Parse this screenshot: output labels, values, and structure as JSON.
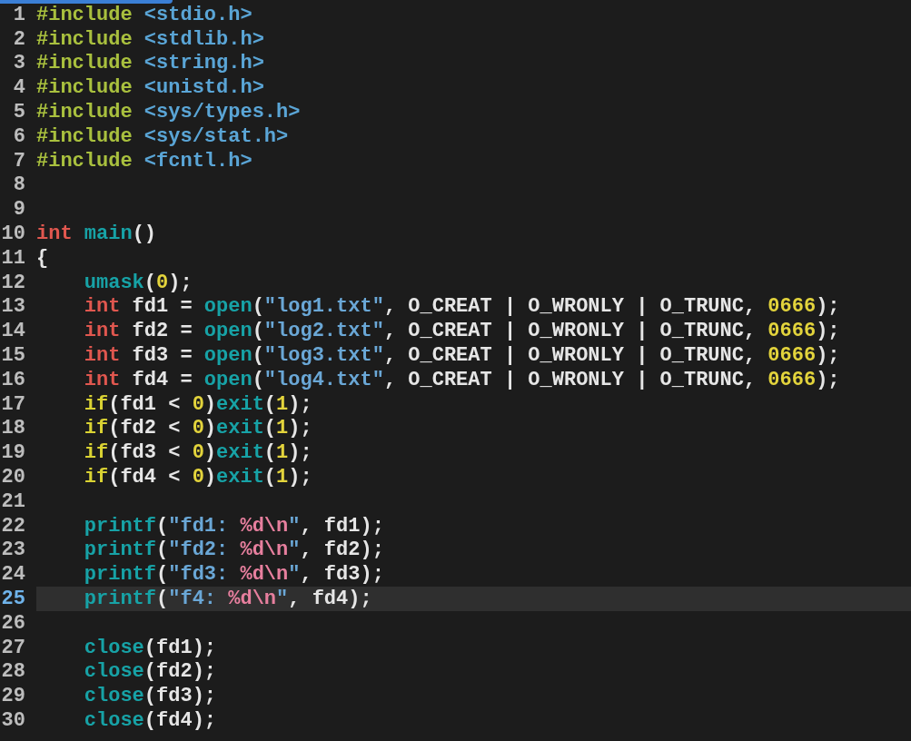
{
  "lines": [
    {
      "number": "1",
      "current": false,
      "tokens": [
        {
          "text": "#include",
          "kind": "preproc"
        },
        {
          "text": " <stdio.h>",
          "kind": "header"
        }
      ]
    },
    {
      "number": "2",
      "current": false,
      "tokens": [
        {
          "text": "#include",
          "kind": "preproc"
        },
        {
          "text": " <stdlib.h>",
          "kind": "header"
        }
      ]
    },
    {
      "number": "3",
      "current": false,
      "tokens": [
        {
          "text": "#include",
          "kind": "preproc"
        },
        {
          "text": " <string.h>",
          "kind": "header"
        }
      ]
    },
    {
      "number": "4",
      "current": false,
      "tokens": [
        {
          "text": "#include",
          "kind": "preproc"
        },
        {
          "text": " <unistd.h>",
          "kind": "header"
        }
      ]
    },
    {
      "number": "5",
      "current": false,
      "tokens": [
        {
          "text": "#include",
          "kind": "preproc"
        },
        {
          "text": " <sys/types.h>",
          "kind": "header"
        }
      ]
    },
    {
      "number": "6",
      "current": false,
      "tokens": [
        {
          "text": "#include",
          "kind": "preproc"
        },
        {
          "text": " <sys/stat.h>",
          "kind": "header"
        }
      ]
    },
    {
      "number": "7",
      "current": false,
      "tokens": [
        {
          "text": "#include",
          "kind": "preproc"
        },
        {
          "text": " <fcntl.h>",
          "kind": "header"
        }
      ]
    },
    {
      "number": "8",
      "current": false
    },
    {
      "number": "9",
      "current": false
    },
    {
      "number": "10",
      "current": false,
      "tokens": [
        {
          "text": "int",
          "kind": "type"
        },
        {
          "text": " main",
          "kind": "func"
        },
        {
          "text": "()",
          "kind": "plain"
        }
      ]
    },
    {
      "number": "11",
      "current": false,
      "tokens": [
        {
          "text": "{",
          "kind": "plain"
        }
      ]
    },
    {
      "number": "12",
      "current": false,
      "tokens": [
        {
          "text": "    umask",
          "kind": "func"
        },
        {
          "text": "(",
          "kind": "plain"
        },
        {
          "text": "0",
          "kind": "number"
        },
        {
          "text": ");",
          "kind": "plain"
        }
      ]
    },
    {
      "number": "13",
      "current": false,
      "tokens": [
        {
          "text": "    int",
          "kind": "type"
        },
        {
          "text": " fd1 = ",
          "kind": "plain"
        },
        {
          "text": "open",
          "kind": "func"
        },
        {
          "text": "(",
          "kind": "plain"
        },
        {
          "text": "\"log1.txt\"",
          "kind": "string"
        },
        {
          "text": ", O_CREAT | O_WRONLY | O_TRUNC, ",
          "kind": "plain"
        },
        {
          "text": "0666",
          "kind": "number"
        },
        {
          "text": ");",
          "kind": "plain"
        }
      ]
    },
    {
      "number": "14",
      "current": false,
      "tokens": [
        {
          "text": "    int",
          "kind": "type"
        },
        {
          "text": " fd2 = ",
          "kind": "plain"
        },
        {
          "text": "open",
          "kind": "func"
        },
        {
          "text": "(",
          "kind": "plain"
        },
        {
          "text": "\"log2.txt\"",
          "kind": "string"
        },
        {
          "text": ", O_CREAT | O_WRONLY | O_TRUNC, ",
          "kind": "plain"
        },
        {
          "text": "0666",
          "kind": "number"
        },
        {
          "text": ");",
          "kind": "plain"
        }
      ]
    },
    {
      "number": "15",
      "current": false,
      "tokens": [
        {
          "text": "    int",
          "kind": "type"
        },
        {
          "text": " fd3 = ",
          "kind": "plain"
        },
        {
          "text": "open",
          "kind": "func"
        },
        {
          "text": "(",
          "kind": "plain"
        },
        {
          "text": "\"log3.txt\"",
          "kind": "string"
        },
        {
          "text": ", O_CREAT | O_WRONLY | O_TRUNC, ",
          "kind": "plain"
        },
        {
          "text": "0666",
          "kind": "number"
        },
        {
          "text": ");",
          "kind": "plain"
        }
      ]
    },
    {
      "number": "16",
      "current": false,
      "tokens": [
        {
          "text": "    int",
          "kind": "type"
        },
        {
          "text": " fd4 = ",
          "kind": "plain"
        },
        {
          "text": "open",
          "kind": "func"
        },
        {
          "text": "(",
          "kind": "plain"
        },
        {
          "text": "\"log4.txt\"",
          "kind": "string"
        },
        {
          "text": ", O_CREAT | O_WRONLY | O_TRUNC, ",
          "kind": "plain"
        },
        {
          "text": "0666",
          "kind": "number"
        },
        {
          "text": ");",
          "kind": "plain"
        }
      ]
    },
    {
      "number": "17",
      "current": false,
      "tokens": [
        {
          "text": "    if",
          "kind": "keyword"
        },
        {
          "text": "(fd1 < ",
          "kind": "plain"
        },
        {
          "text": "0",
          "kind": "number"
        },
        {
          "text": ")",
          "kind": "plain"
        },
        {
          "text": "exit",
          "kind": "func"
        },
        {
          "text": "(",
          "kind": "plain"
        },
        {
          "text": "1",
          "kind": "number"
        },
        {
          "text": ");",
          "kind": "plain"
        }
      ]
    },
    {
      "number": "18",
      "current": false,
      "tokens": [
        {
          "text": "    if",
          "kind": "keyword"
        },
        {
          "text": "(fd2 < ",
          "kind": "plain"
        },
        {
          "text": "0",
          "kind": "number"
        },
        {
          "text": ")",
          "kind": "plain"
        },
        {
          "text": "exit",
          "kind": "func"
        },
        {
          "text": "(",
          "kind": "plain"
        },
        {
          "text": "1",
          "kind": "number"
        },
        {
          "text": ");",
          "kind": "plain"
        }
      ]
    },
    {
      "number": "19",
      "current": false,
      "tokens": [
        {
          "text": "    if",
          "kind": "keyword"
        },
        {
          "text": "(fd3 < ",
          "kind": "plain"
        },
        {
          "text": "0",
          "kind": "number"
        },
        {
          "text": ")",
          "kind": "plain"
        },
        {
          "text": "exit",
          "kind": "func"
        },
        {
          "text": "(",
          "kind": "plain"
        },
        {
          "text": "1",
          "kind": "number"
        },
        {
          "text": ");",
          "kind": "plain"
        }
      ]
    },
    {
      "number": "20",
      "current": false,
      "tokens": [
        {
          "text": "    if",
          "kind": "keyword"
        },
        {
          "text": "(fd4 < ",
          "kind": "plain"
        },
        {
          "text": "0",
          "kind": "number"
        },
        {
          "text": ")",
          "kind": "plain"
        },
        {
          "text": "exit",
          "kind": "func"
        },
        {
          "text": "(",
          "kind": "plain"
        },
        {
          "text": "1",
          "kind": "number"
        },
        {
          "text": ");",
          "kind": "plain"
        }
      ]
    },
    {
      "number": "21",
      "current": false
    },
    {
      "number": "22",
      "current": false,
      "tokens": [
        {
          "text": "    printf",
          "kind": "func"
        },
        {
          "text": "(",
          "kind": "plain"
        },
        {
          "text": "\"fd1: ",
          "kind": "string"
        },
        {
          "text": "%d\\n",
          "kind": "escape"
        },
        {
          "text": "\"",
          "kind": "string"
        },
        {
          "text": ", fd1);",
          "kind": "plain"
        }
      ]
    },
    {
      "number": "23",
      "current": false,
      "tokens": [
        {
          "text": "    printf",
          "kind": "func"
        },
        {
          "text": "(",
          "kind": "plain"
        },
        {
          "text": "\"fd2: ",
          "kind": "string"
        },
        {
          "text": "%d\\n",
          "kind": "escape"
        },
        {
          "text": "\"",
          "kind": "string"
        },
        {
          "text": ", fd2);",
          "kind": "plain"
        }
      ]
    },
    {
      "number": "24",
      "current": false,
      "tokens": [
        {
          "text": "    printf",
          "kind": "func"
        },
        {
          "text": "(",
          "kind": "plain"
        },
        {
          "text": "\"fd3: ",
          "kind": "string"
        },
        {
          "text": "%d\\n",
          "kind": "escape"
        },
        {
          "text": "\"",
          "kind": "string"
        },
        {
          "text": ", fd3);",
          "kind": "plain"
        }
      ]
    },
    {
      "number": "25",
      "current": true,
      "tokens": [
        {
          "text": "    printf",
          "kind": "func"
        },
        {
          "text": "(",
          "kind": "plain"
        },
        {
          "text": "\"f4: ",
          "kind": "string"
        },
        {
          "text": "%d\\n",
          "kind": "escape"
        },
        {
          "text": "\"",
          "kind": "string"
        },
        {
          "text": ", fd4);",
          "kind": "plain"
        }
      ]
    },
    {
      "number": "26",
      "current": false
    },
    {
      "number": "27",
      "current": false,
      "tokens": [
        {
          "text": "    close",
          "kind": "func"
        },
        {
          "text": "(fd1);",
          "kind": "plain"
        }
      ]
    },
    {
      "number": "28",
      "current": false,
      "tokens": [
        {
          "text": "    close",
          "kind": "func"
        },
        {
          "text": "(fd2);",
          "kind": "plain"
        }
      ]
    },
    {
      "number": "29",
      "current": false,
      "tokens": [
        {
          "text": "    close",
          "kind": "func"
        },
        {
          "text": "(fd3);",
          "kind": "plain"
        }
      ]
    },
    {
      "number": "30",
      "current": false,
      "tokens": [
        {
          "text": "    close",
          "kind": "func"
        },
        {
          "text": "(fd4);",
          "kind": "plain"
        }
      ]
    }
  ]
}
